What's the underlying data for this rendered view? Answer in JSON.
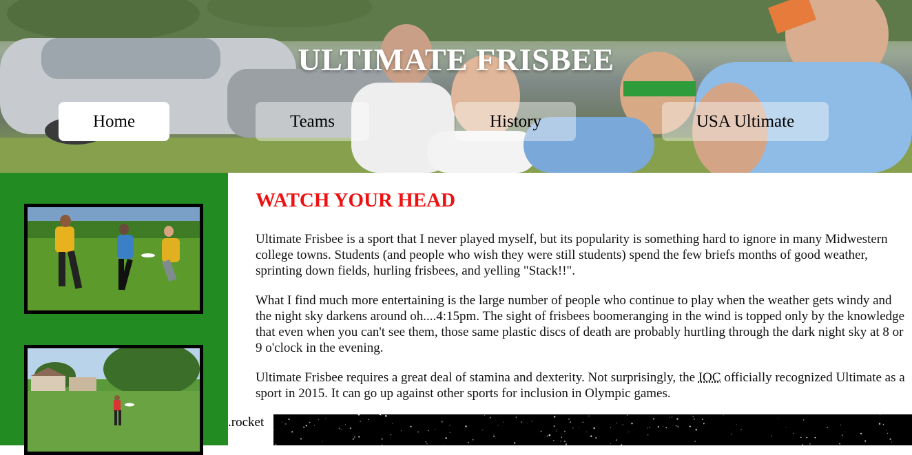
{
  "header": {
    "title": "ULTIMATE FRISBEE",
    "nav": [
      {
        "label": "Home",
        "active": true
      },
      {
        "label": "Teams",
        "active": false
      },
      {
        "label": "History",
        "active": false
      },
      {
        "label": "USA Ultimate",
        "active": false
      }
    ]
  },
  "main": {
    "headline": "WATCH YOUR HEAD",
    "paragraphs": [
      "Ultimate Frisbee is a sport that I never played myself, but its popularity is something hard to ignore in many Midwestern college towns. Students (and people who wish they were still students) spend the few briefs months of good weather, sprinting down fields, hurling frisbees, and yelling \"Stack!!\".",
      "What I find much more entertaining is the large number of people who continue to play when the weather gets windy and the night sky darkens around oh....4:15pm. The sight of frisbees boomeranging in the wind is topped only by the knowledge that even when you can't see them, those same plastic discs of death are probably hurtling through the dark night sky at 8 or 9 o'clock in the evening."
    ],
    "paragraph3": {
      "before": "Ultimate Frisbee requires a great deal of stamina and dexterity. Not surprisingly, the ",
      "abbr": "IOC",
      "after": " officially recognized Ultimate as a sport in 2015. It can go up against other sports for inclusion in Olympic games."
    },
    "rocket_label": ".rocket"
  },
  "colors": {
    "sidebar": "#228b22",
    "headline": "#ee1111",
    "nav_active": "#ffffff",
    "nav_inactive": "rgba(255,255,255,0.42)"
  }
}
